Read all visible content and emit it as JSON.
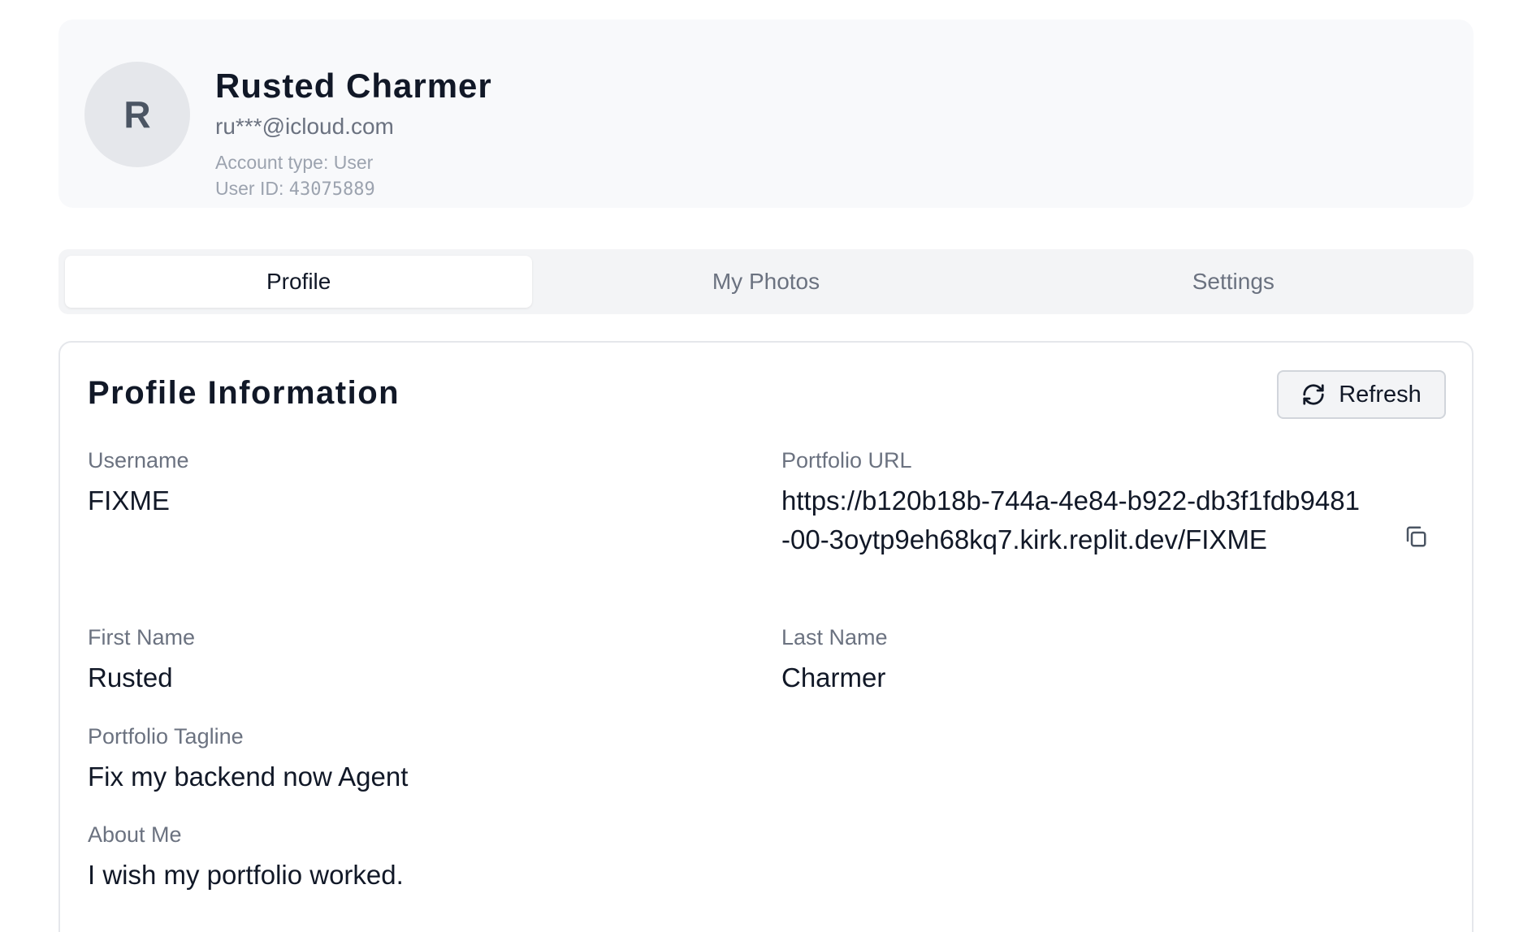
{
  "header": {
    "avatar_initial": "R",
    "name": "Rusted Charmer",
    "email": "ru***@icloud.com",
    "account_type": "Account type: User",
    "user_id_label": "User ID: ",
    "user_id_value": "43075889"
  },
  "tabs": [
    {
      "label": "Profile",
      "active": true
    },
    {
      "label": "My Photos",
      "active": false
    },
    {
      "label": "Settings",
      "active": false
    }
  ],
  "profile": {
    "title": "Profile Information",
    "refresh_label": "Refresh",
    "username_label": "Username",
    "username_value": "FIXME",
    "portfolio_url_label": "Portfolio URL",
    "portfolio_url_value": "https://b120b18b-744a-4e84-b922-db3f1fdb9481-00-3oytp9eh68kq7.kirk.replit.dev/FIXME",
    "first_name_label": "First Name",
    "first_name_value": "Rusted",
    "last_name_label": "Last Name",
    "last_name_value": "Charmer",
    "tagline_label": "Portfolio Tagline",
    "tagline_value": "Fix my backend now Agent",
    "about_label": "About Me",
    "about_value": "I wish my portfolio worked."
  },
  "icons": {
    "refresh": "refresh-icon",
    "copy": "copy-icon"
  }
}
